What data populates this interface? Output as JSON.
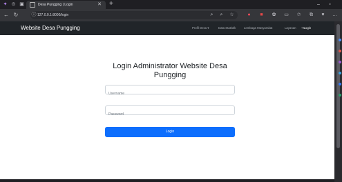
{
  "browser": {
    "tab_title": "Desa Pungging | Login",
    "url": "127.0.0.1:8000/login",
    "colors": {
      "chrome_dark": "#202124",
      "toolbar": "#35363a"
    }
  },
  "site": {
    "brand": "Website Desa Pungging",
    "nav": {
      "profil": "Profil Desa",
      "statistik": "Data Statistik",
      "lembaga": "Lembaga Masyarakat",
      "layanan": "Layanan",
      "login": "Login"
    }
  },
  "login": {
    "title": "Login Administrator Website Desa Pungging",
    "username_placeholder": "Username",
    "password_placeholder": "Password",
    "button": "Login"
  },
  "colors": {
    "navbar": "#212529",
    "primary": "#0d6efd"
  }
}
